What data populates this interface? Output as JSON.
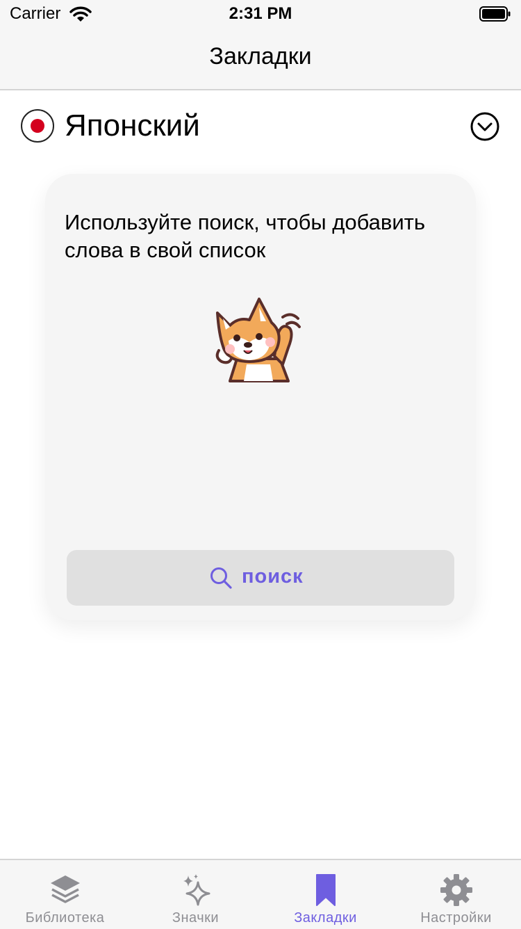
{
  "status_bar": {
    "carrier": "Carrier",
    "time": "2:31 PM"
  },
  "nav": {
    "title": "Закладки"
  },
  "language": {
    "name": "Японский",
    "flag_icon": "japan-flag-icon",
    "toggle_icon": "chevron-down-circle-icon"
  },
  "empty_state": {
    "message": "Используйте поиск, чтобы добавить слова в свой список",
    "illustration": "shiba-dog-waving-icon",
    "search_label": "поиск",
    "search_icon": "magnifier-icon"
  },
  "tabs": [
    {
      "label": "Библиотека",
      "icon": "layers-icon",
      "active": false
    },
    {
      "label": "Значки",
      "icon": "sparkles-icon",
      "active": false
    },
    {
      "label": "Закладки",
      "icon": "bookmark-icon",
      "active": true
    },
    {
      "label": "Настройки",
      "icon": "gear-icon",
      "active": false
    }
  ],
  "colors": {
    "accent": "#6e5ee0",
    "inactive": "#8e8e93",
    "flag_red": "#d4001e",
    "card_bg": "#f5f5f5",
    "button_bg": "#e0e0e0"
  }
}
